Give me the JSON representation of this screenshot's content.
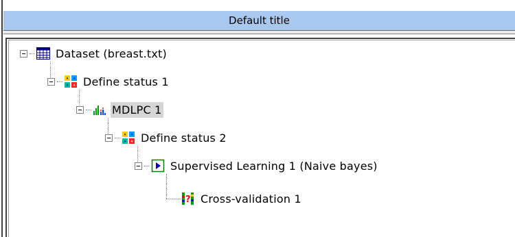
{
  "window": {
    "title": "Default title"
  },
  "tree": {
    "nodes": [
      {
        "label": "Dataset (breast.txt)",
        "icon": "dataset-table-icon"
      },
      {
        "label": "Define status 1",
        "icon": "define-status-icon"
      },
      {
        "label": "MDLPC 1",
        "icon": "discretization-chart-icon"
      },
      {
        "label": "Define status 2",
        "icon": "define-status-icon"
      },
      {
        "label": "Supervised Learning 1 (Naive bayes)",
        "icon": "supervised-learning-play-icon"
      },
      {
        "label": "Cross-validation 1",
        "icon": "cross-validation-icon"
      }
    ]
  },
  "colors": {
    "titlebar_bg": "#a8c8f0",
    "selection_bg": "#d6d6d6"
  }
}
